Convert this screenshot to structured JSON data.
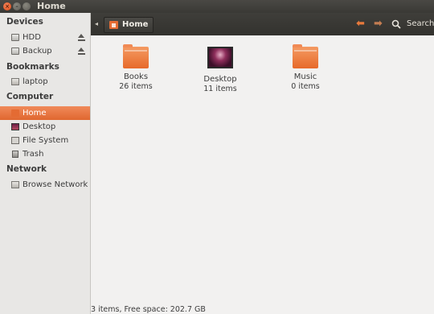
{
  "window": {
    "title": "Home"
  },
  "sidebar": {
    "sections": [
      {
        "header": "Devices",
        "items": [
          {
            "label": "HDD",
            "icon": "drive-icon",
            "eject": true
          },
          {
            "label": "Backup",
            "icon": "drive-icon",
            "eject": true
          }
        ]
      },
      {
        "header": "Bookmarks",
        "items": [
          {
            "label": "laptop",
            "icon": "network-share-icon"
          }
        ]
      },
      {
        "header": "Computer",
        "items": [
          {
            "label": "Home",
            "icon": "home-folder-icon",
            "active": true
          },
          {
            "label": "Desktop",
            "icon": "desktop-icon"
          },
          {
            "label": "File System",
            "icon": "filesystem-icon"
          },
          {
            "label": "Trash",
            "icon": "trash-icon"
          }
        ]
      },
      {
        "header": "Network",
        "items": [
          {
            "label": "Browse Network",
            "icon": "network-icon"
          }
        ]
      }
    ]
  },
  "toolbar": {
    "location": "Home",
    "search_label": "Search"
  },
  "content": {
    "items": [
      {
        "name": "Books",
        "count": "26 items",
        "icon": "folder-icon"
      },
      {
        "name": "Desktop",
        "count": "11 items",
        "icon": "desktop-folder-icon"
      },
      {
        "name": "Music",
        "count": "0 items",
        "icon": "folder-icon"
      }
    ]
  },
  "statusbar": {
    "text": "3 items, Free space: 202.7 GB"
  },
  "colors": {
    "accent": "#e46b33",
    "titlebar": "#3c3b37",
    "sidebar": "#e8e7e5"
  }
}
